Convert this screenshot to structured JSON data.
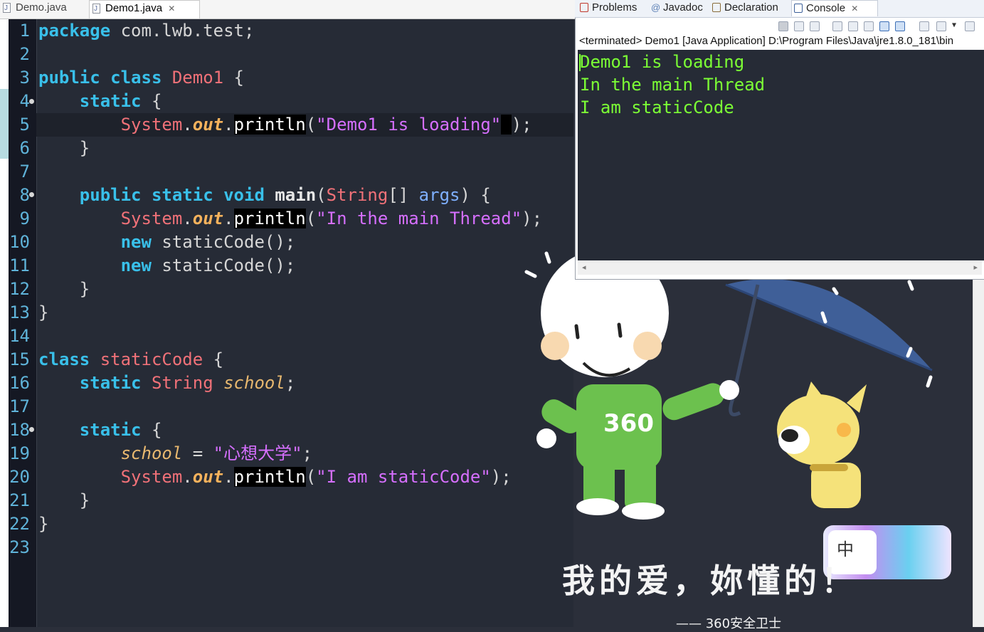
{
  "editor": {
    "tabs": [
      {
        "label": "Demo.java",
        "active": false
      },
      {
        "label": "Demo1.java",
        "active": true
      }
    ],
    "line_numbers": [
      "1",
      "2",
      "3",
      "4",
      "5",
      "6",
      "7",
      "8",
      "9",
      "10",
      "11",
      "12",
      "13",
      "14",
      "15",
      "16",
      "17",
      "18",
      "19",
      "20",
      "21",
      "22",
      "23"
    ]
  },
  "console": {
    "tabs": [
      {
        "label": "Problems",
        "icon": "problems-icon"
      },
      {
        "label": "Javadoc",
        "icon": "at-icon"
      },
      {
        "label": "Declaration",
        "icon": "declaration-icon"
      },
      {
        "label": "Console",
        "icon": "console-icon",
        "active": true
      }
    ],
    "status": "<terminated> Demo1 [Java Application] D:\\Program Files\\Java\\jre1.8.0_181\\bin",
    "output": [
      "Demo1 is loading",
      "In the main Thread",
      "I am staticCode"
    ]
  },
  "overlay": {
    "ime_char": "中",
    "shirt_text": "360",
    "slogan": "我的爱，妳懂的！",
    "slogan_sub": "—— 360安全卫士"
  },
  "colors": {
    "editor_bg": "#262b36",
    "keyword": "#39c0ea",
    "class_name": "#f07178",
    "string": "#d66fff",
    "console_text": "#7cff35"
  }
}
